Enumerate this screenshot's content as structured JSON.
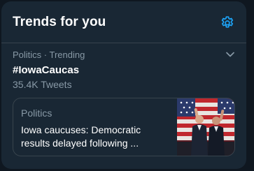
{
  "widget": {
    "title": "Trends for you",
    "settings_icon": "gear-icon"
  },
  "trend": {
    "meta": "Politics · Trending",
    "name": "#IowaCaucas",
    "tweet_count": "35.4K Tweets",
    "more_icon": "chevron-down-icon"
  },
  "news_card": {
    "category": "Politics",
    "headline": "Iowa caucuses: Democratic results delayed following ...",
    "thumbnail": "news-photo-flags-stage"
  },
  "colors": {
    "accent": "#1da1f2",
    "background": "#192734",
    "text_primary": "#ffffff",
    "text_secondary": "#8899a6",
    "border": "#38444d"
  }
}
